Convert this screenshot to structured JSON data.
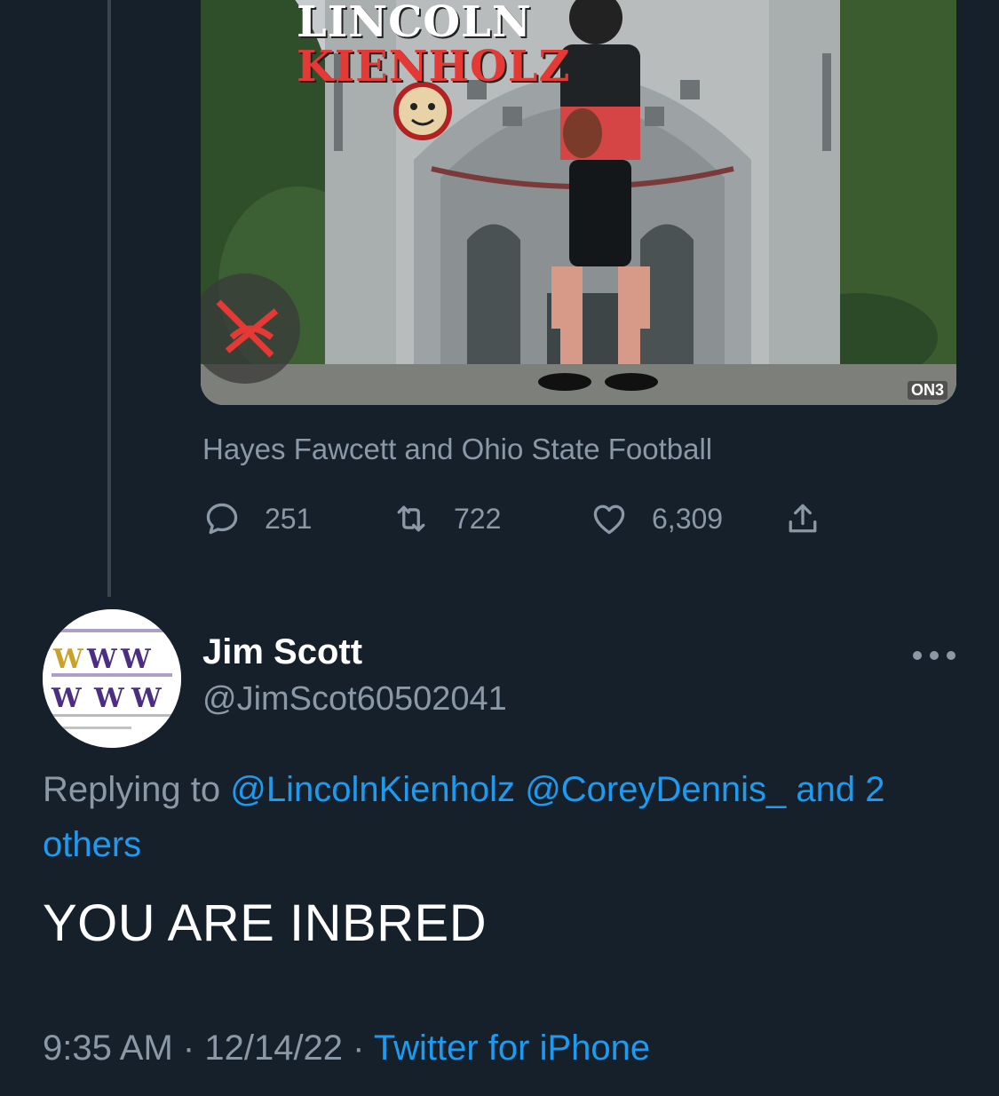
{
  "media": {
    "title_line1": "LINCOLN",
    "title_line2": "KIENHOLZ",
    "watermark": "ON3",
    "caption": "Hayes Fawcett and Ohio State Football"
  },
  "original_tweet": {
    "stats": {
      "replies": "251",
      "retweets": "722",
      "likes": "6,309"
    }
  },
  "reply_tweet": {
    "display_name": "Jim Scott",
    "handle": "@JimScot60502041",
    "replying_prefix": "Replying to",
    "mention_1": "@LincolnKienholz",
    "mention_2": "@CoreyDennis_",
    "mention_more": "and 2 others",
    "text": "YOU ARE INBRED",
    "time": "9:35 AM",
    "date": "12/14/22",
    "source": "Twitter for iPhone",
    "separator": "·"
  },
  "icons": {
    "reply": "reply-icon",
    "retweet": "retweet-icon",
    "like": "heart-icon",
    "share": "share-icon",
    "more": "more-icon"
  },
  "colors": {
    "background": "#15202b",
    "secondary_text": "#8b98a5",
    "link": "#1d9bf0",
    "thread_line": "#38444d"
  }
}
